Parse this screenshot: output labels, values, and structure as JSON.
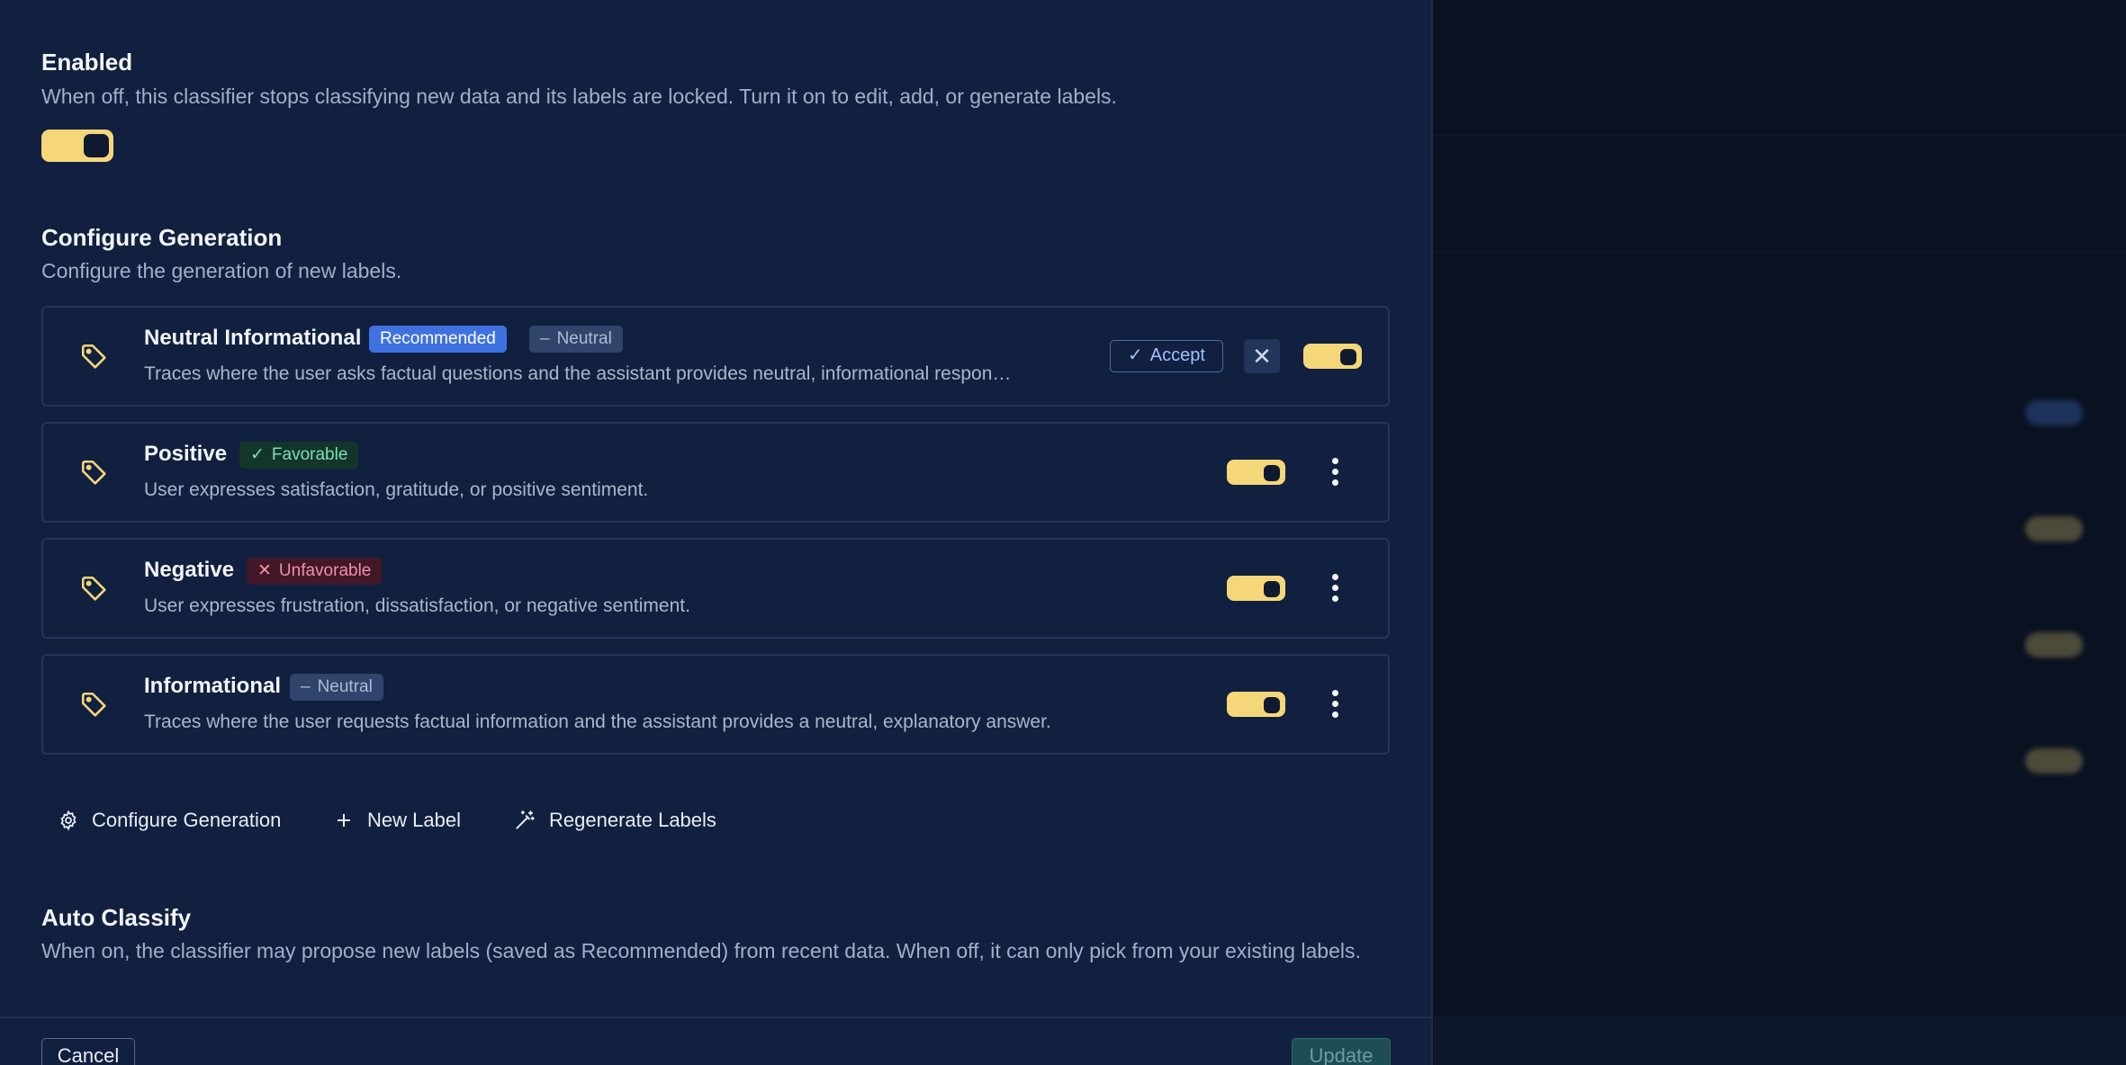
{
  "enabled": {
    "title": "Enabled",
    "description": "When off, this classifier stops classifying new data and its labels are locked. Turn it on to edit, add, or generate labels.",
    "toggle_on": true
  },
  "configure_generation": {
    "title": "Configure Generation",
    "description": "Configure the generation of new labels."
  },
  "labels": [
    {
      "name": "Neutral Informational",
      "badges": [
        {
          "text": "Recommended",
          "kind": "recommended"
        },
        {
          "text": "Neutral",
          "kind": "neutral",
          "icon": "minus-icon"
        }
      ],
      "description": "Traces where the user asks factual questions and the assistant provides neutral, informational respon…",
      "accept_label": "Accept",
      "enabled": true
    },
    {
      "name": "Positive",
      "badges": [
        {
          "text": "Favorable",
          "kind": "favorable",
          "icon": "check-icon"
        }
      ],
      "description": "User expresses satisfaction, gratitude, or positive sentiment.",
      "enabled": true
    },
    {
      "name": "Negative",
      "badges": [
        {
          "text": "Unfavorable",
          "kind": "unfavorable",
          "icon": "x-icon"
        }
      ],
      "description": "User expresses frustration, dissatisfaction, or negative sentiment.",
      "enabled": true
    },
    {
      "name": "Informational",
      "badges": [
        {
          "text": "Neutral",
          "kind": "neutral",
          "icon": "minus-icon"
        }
      ],
      "description": "Traces where the user requests factual information and the assistant provides a neutral, explanatory answer.",
      "enabled": true
    }
  ],
  "actions": {
    "configure_generation": "Configure Generation",
    "new_label": "New Label",
    "regenerate_labels": "Regenerate Labels"
  },
  "auto_classify": {
    "title": "Auto Classify",
    "description": "When on, the classifier may propose new labels (saved as Recommended) from recent data. When off, it can only pick from your existing labels."
  },
  "footer": {
    "cancel": "Cancel",
    "update": "Update"
  },
  "colors": {
    "accent_toggle": "#f5d77a",
    "panel_bg": "#12203f",
    "recommended": "#3f72e0"
  }
}
